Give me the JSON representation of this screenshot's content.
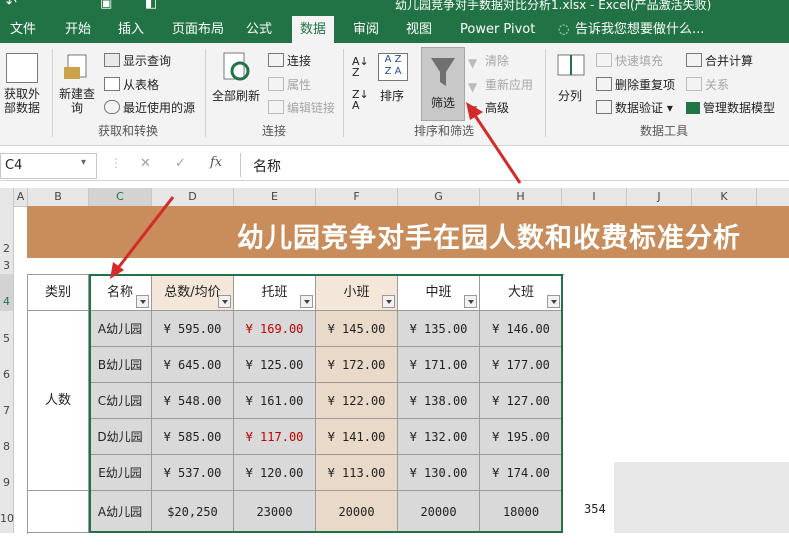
{
  "window": {
    "title": "幼儿园竞争对手数据对比分析1.xlsx - Excel(产品激活失败)"
  },
  "tabs": [
    "文件",
    "开始",
    "插入",
    "页面布局",
    "公式",
    "数据",
    "审阅",
    "视图",
    "Power Pivot"
  ],
  "active_tab": "数据",
  "tell_me": "告诉我您想要做什么...",
  "ribbon": {
    "get_external": "获取外部数据",
    "new_query": "新建查询",
    "show_queries": "显示查询",
    "from_table": "从表格",
    "recent_sources": "最近使用的源",
    "group_get_transform": "获取和转换",
    "refresh_all": "全部刷新",
    "connections": "连接",
    "properties": "属性",
    "edit_links": "编辑链接",
    "group_connections": "连接",
    "sort": "排序",
    "filter": "筛选",
    "clear": "清除",
    "reapply": "重新应用",
    "advanced": "高级",
    "group_sort_filter": "排序和筛选",
    "text_to_columns": "分列",
    "flash_fill": "快速填充",
    "remove_duplicates": "删除重复项",
    "data_validation": "数据验证",
    "consolidate": "合并计算",
    "relationships": "关系",
    "manage_model": "管理数据模型",
    "group_data_tools": "数据工具"
  },
  "formula_bar": {
    "name_box": "C4",
    "cancel": "✕",
    "enter": "✓",
    "fx": "fx",
    "content": "名称"
  },
  "columns": [
    "A",
    "B",
    "C",
    "D",
    "E",
    "F",
    "G",
    "H",
    "I",
    "J",
    "K"
  ],
  "rows": [
    "2",
    "3",
    "4",
    "5",
    "6",
    "7",
    "8",
    "9",
    "10"
  ],
  "banner": "幼儿园竞争对手在园人数和收费标准分析",
  "table": {
    "headers": [
      "类别",
      "名称",
      "总数/均价",
      "托班",
      "小班",
      "中班",
      "大班"
    ],
    "group_label": "人数",
    "rows": [
      [
        "A幼儿园",
        "¥ 595.00",
        "¥ 169.00",
        "¥ 145.00",
        "¥ 135.00",
        "¥ 146.00"
      ],
      [
        "B幼儿园",
        "¥ 645.00",
        "¥ 125.00",
        "¥ 172.00",
        "¥ 171.00",
        "¥ 177.00"
      ],
      [
        "C幼儿园",
        "¥ 548.00",
        "¥ 161.00",
        "¥ 122.00",
        "¥ 138.00",
        "¥ 127.00"
      ],
      [
        "D幼儿园",
        "¥ 585.00",
        "¥ 117.00",
        "¥ 141.00",
        "¥ 132.00",
        "¥ 195.00"
      ],
      [
        "E幼儿园",
        "¥ 537.00",
        "¥ 120.00",
        "¥ 113.00",
        "¥ 130.00",
        "¥ 174.00"
      ],
      [
        "A幼儿园",
        "$20,250",
        "23000",
        "20000",
        "20000",
        "18000"
      ]
    ],
    "extra_value": "354",
    "red_color": "#c00000"
  },
  "colors": {
    "excel_green": "#217346",
    "banner": "#c98c5b",
    "arrow": "#d42a2a"
  }
}
